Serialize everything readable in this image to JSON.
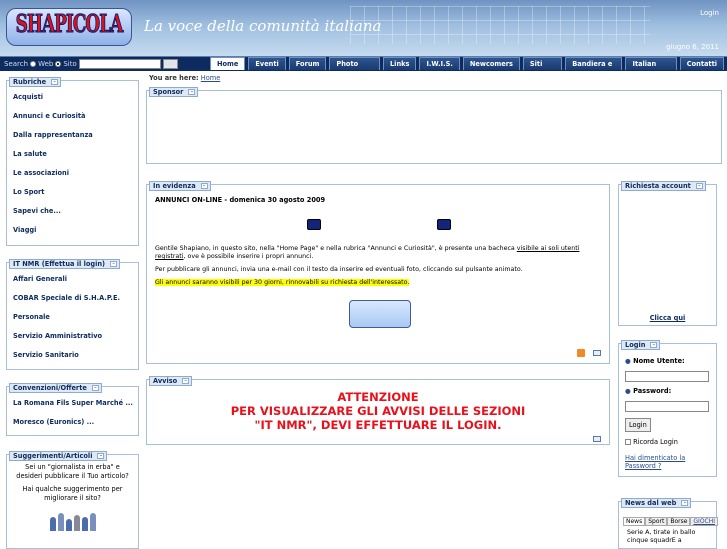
{
  "header": {
    "logo_text": "SHAPICOLA",
    "tagline": "La voce della comunità italiana",
    "login_link": "Login",
    "date": "giugno 6, 2011"
  },
  "search": {
    "label": "Search",
    "option_web": "Web",
    "option_site": "Sito",
    "go_label": "Go!",
    "placeholder": ""
  },
  "tabs": [
    "Home",
    "Eventi",
    "Forum",
    "Photo gallery",
    "Links",
    "I.W.I.S.",
    "Newcomers",
    "Siti amici",
    "Bandiera e Inno",
    "Italian School",
    "Contatti"
  ],
  "breadcrumb": {
    "label": "You are here:",
    "link": "Home"
  },
  "left": {
    "rubriche": {
      "title": "Rubriche",
      "items": [
        "Acquisti",
        "Annunci e Curiosità",
        "Dalla rappresentanza",
        "La salute",
        "Le associazioni",
        "Lo Sport",
        "Sapevi che...",
        "Viaggi"
      ]
    },
    "itnmr": {
      "title": "IT NMR (Effettua il login)",
      "items": [
        "Affari Generali",
        "COBAR Speciale di S.H.A.P.E.",
        "Personale",
        "Servizio Amministrativo",
        "Servizio Sanitario"
      ]
    },
    "convenzioni": {
      "title": "Convenzioni/Offerte",
      "items": [
        "La Romana Fils Super Marché",
        "Moresco (Euronics)"
      ],
      "more": "..."
    },
    "suggerimenti": {
      "title": "Suggerimenti/Articoli",
      "text1": "Sei un \"giornalista in erba\" e desideri pubblicare il Tuo articolo?",
      "text2": "Hai qualche suggerimento per migliorare il sito?"
    }
  },
  "sponsor": {
    "title": "Sponsor"
  },
  "evidenza": {
    "title": "In evidenza",
    "heading": "ANNUNCI ON-LINE - domenica 30 agosto 2009",
    "p1a": "Gentile Shapiano, in questo sito, nella \"Home Page\" e nella rubrica \"Annunci e Curiosità\",  è presente una bacheca ",
    "p1link": "visibile ai soli utenti registrati",
    "p1b": ", ove è possibile inserire i propri annunci.",
    "p2": "Per pubblicare gli annunci, invia una e-mail con il testo da inserire ed eventuali foto, cliccando sul pulsante animato.",
    "p3": "Gli annunci saranno visibili per 30 giorni, rinnovabili su richiesta dell'interessato."
  },
  "avviso": {
    "title": "Avviso",
    "line1": "ATTENZIONE",
    "line2": "PER VISUALIZZARE GLI AVVISI DELLE SEZIONI",
    "line3": "\"IT NMR\", DEVI EFFETTUARE IL LOGIN."
  },
  "right": {
    "richiesta": {
      "title": "Richiesta account",
      "link": "Clicca qui"
    },
    "login": {
      "title": "Login",
      "user_label": "Nome Utente:",
      "pass_label": "Password:",
      "button": "Login",
      "remember": "Ricorda Login",
      "forgot": "Hai dimenticato la Password ?"
    },
    "news": {
      "title": "News dal web",
      "tabs": [
        "News",
        "Sport",
        "Borse",
        "GIOCHI"
      ],
      "text": "Serie A, tirate in ballo cinque squadrE a"
    }
  },
  "colors": {
    "accent": "#0d2b5f",
    "alert": "#e8101a",
    "highlight": "#ffff00"
  }
}
